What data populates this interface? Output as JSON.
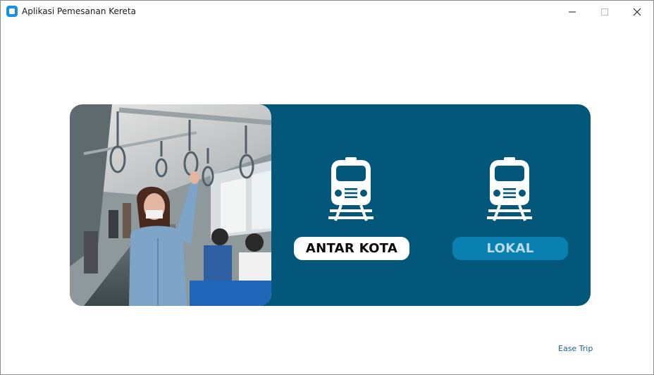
{
  "window": {
    "title": "Aplikasi Pemesanan Kereta",
    "icon": "app-icon"
  },
  "colors": {
    "panel": "#02577a",
    "antar_button_bg": "#ffffff",
    "lokal_button_bg": "#0a80b0",
    "footer_link": "#1d5e8a"
  },
  "photo": {
    "subject": "woman-holding-handrail-in-train-carriage"
  },
  "options": [
    {
      "label": "ANTAR KOTA",
      "icon": "train-icon"
    },
    {
      "label": "LOKAL",
      "icon": "train-icon"
    }
  ],
  "footer": {
    "link": "Ease Trip"
  }
}
